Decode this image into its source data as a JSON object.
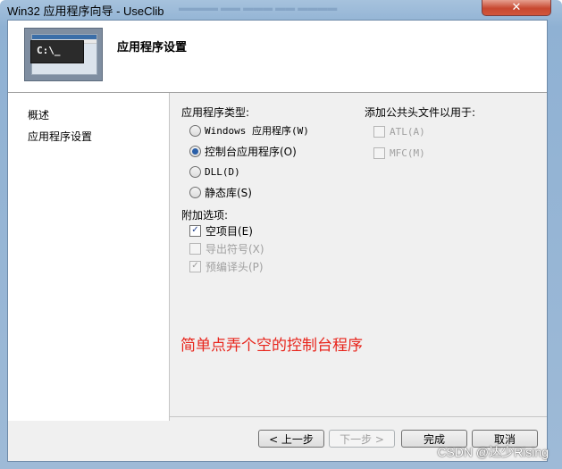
{
  "window": {
    "title": "Win32 应用程序向导 - UseClib",
    "close_glyph": "✕"
  },
  "header": {
    "title": "应用程序设置",
    "banner_prompt": "C:\\_"
  },
  "nav": {
    "items": [
      {
        "label": "概述"
      },
      {
        "label": "应用程序设置"
      }
    ]
  },
  "app_type": {
    "label": "应用程序类型:",
    "options": [
      {
        "label": "Windows 应用程序(W)",
        "selected": false
      },
      {
        "label": "控制台应用程序(O)",
        "selected": true
      },
      {
        "label": "DLL(D)",
        "selected": false
      },
      {
        "label": "静态库(S)",
        "selected": false
      }
    ]
  },
  "common_headers": {
    "label": "添加公共头文件以用于:",
    "options": [
      {
        "label": "ATL(A)",
        "checked": false,
        "enabled": false
      },
      {
        "label": "MFC(M)",
        "checked": false,
        "enabled": false
      }
    ]
  },
  "extra_options": {
    "label": "附加选项:",
    "options": [
      {
        "label": "空项目(E)",
        "checked": true,
        "enabled": true
      },
      {
        "label": "导出符号(X)",
        "checked": false,
        "enabled": false
      },
      {
        "label": "预编译头(P)",
        "checked": true,
        "enabled": false
      }
    ]
  },
  "annotation": "简单点弄个空的控制台程序",
  "buttons": {
    "prev": "< 上一步",
    "next": "下一步 >",
    "finish": "完成",
    "cancel": "取消"
  },
  "watermark": "CSDN @达少Rising"
}
